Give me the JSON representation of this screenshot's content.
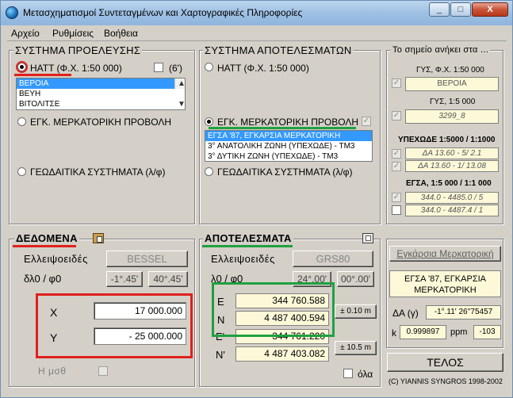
{
  "window": {
    "title": "Μετασχηματισμοί Συντεταγμένων και Χαρτογραφικές Πληροφορίες",
    "minimize": "_",
    "maximize": "□",
    "close": "X"
  },
  "menu": [
    "Αρχείο",
    "Ρυθμίσεις",
    "Βοήθεια"
  ],
  "source": {
    "title": "ΣΥΣΤΗΜΑ ΠΡΟΕΛΕΥΣΗΣ",
    "hatt_label": "ΗΑΤΤ (Φ.Χ. 1:50 000)",
    "six_label": "(6')",
    "sheets": [
      "ΒΕΡΟΙΑ",
      "ΒΕΥΗ",
      "ΒΙΤΟΛΙΤΣΕ"
    ],
    "tm_label": "ΕΓΚ. ΜΕΡΚΑΤΟΡΙΚΗ ΠΡΟΒΟΛΗ",
    "geo_label": "ΓΕΩΔΑΙΤΙΚΑ ΣΥΣΤΗΜΑΤΑ (λ/φ)"
  },
  "results_system": {
    "title": "ΣΥΣΤΗΜΑ ΑΠΟΤΕΛΕΣΜΑΤΩΝ",
    "hatt_label": "ΗΑΤΤ (Φ.Χ. 1:50 000)",
    "tm_label": "ΕΓΚ. ΜΕΡΚΑΤΟΡΙΚΗ ΠΡΟΒΟΛΗ",
    "tm_options": [
      "ΕΓΣΑ '87, ΕΓΚΑΡΣΙΑ ΜΕΡΚΑΤΟΡΙΚΗ",
      "3° ΑΝΑΤΟΛΙΚΗ ΖΩΝΗ (ΥΠΕΧΩΔΕ) - ΤΜ3",
      "3° ΔΥΤΙΚΗ ΖΩΝΗ (ΥΠΕΧΩΔΕ) - ΤΜ3"
    ],
    "geo_label": "ΓΕΩΔΑΙΤΙΚΑ ΣΥΣΤΗΜΑΤΑ (λ/φ)"
  },
  "belongs": {
    "title": "Το σημείο ανήκει στα ...",
    "gys50_label": "ΓΥΣ, Φ.Χ. 1:50 000",
    "gys50_value": "ΒΕΡΟΙΑ",
    "gys5_label": "ΓΥΣ,  1:5 000",
    "gys5_value": "3299_8",
    "ypexode_label": "ΥΠΕΧΩΔΕ 1:5000 / 1:1000",
    "ypexode_values": [
      "ΔΑ 13.60 - 5/ 2.1",
      "ΔΑ 13.60 - 1/ 13.08"
    ],
    "egsa_label": "ΕΓΣΑ, 1:5 000 / 1:1 000",
    "egsa_values": [
      "344.0 - 4485.0 / 5",
      "344.0 - 4487.4 / 1"
    ]
  },
  "data": {
    "title": "ΔΕΔΟΜΕΝΑ",
    "ellipsoid_label": "Ελλειψοειδές",
    "ellipsoid": "BESSEL",
    "dl_label": "δλ0 / φ0",
    "dl": "-1°.45'",
    "phi": "40°.45'",
    "x_label": "X",
    "x": "17 000.000",
    "y_label": "Y",
    "y": "- 25 000.000",
    "h_label": "Η μσθ"
  },
  "results": {
    "title": "ΑΠΟΤΕΛΕΣΜΑΤΑ",
    "ellipsoid_label": "Ελλειψοειδές",
    "ellipsoid": "GRS80",
    "l_label": "λ0 / φ0",
    "l": "24°.00'",
    "phi": "00°.00'",
    "e_label": "E",
    "e": "344 760.588",
    "n_label": "N",
    "n": "4 487 400.594",
    "e2_label": "E'",
    "e2": "344 761.220",
    "n2_label": "N'",
    "n2": "4 487 403.082",
    "acc1": "± 0.10 m",
    "acc2": "± 10.5 m",
    "all_label": "όλα"
  },
  "tm_panel": {
    "button": "Εγκάρσια Μερκατορική",
    "projection": "ΕΓΣΑ '87, ΕΓΚΑΡΣΙΑ ΜΕΡΚΑΤΟΡΙΚΗ",
    "dg_label": "ΔΑ (γ)",
    "dg": "-1°.11' 26''75457",
    "k_label": "k",
    "k": "0.999897",
    "ppm_label": "ppm",
    "ppm": "-103",
    "exit": "ΤΕΛΟΣ",
    "copyright": "(C) YIANNIS SYNGROS 1998-2002"
  }
}
